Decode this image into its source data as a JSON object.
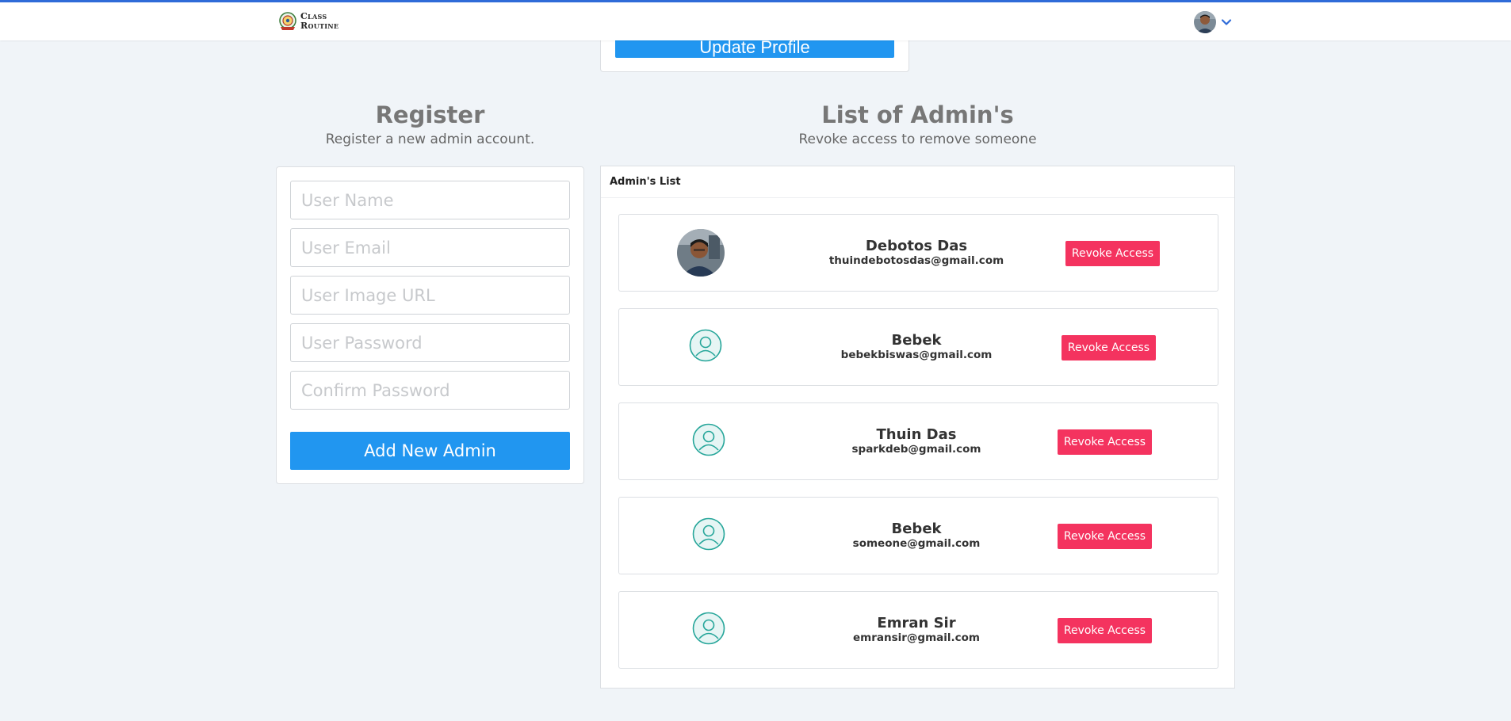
{
  "nav": {
    "brand_line1": "Class",
    "brand_line2": "Routine",
    "logo_icon": "class-routine-logo-icon",
    "dropdown_icon": "chevron-down-icon"
  },
  "profile": {
    "update_label": "Update Profile"
  },
  "register": {
    "title": "Register",
    "subtitle": "Register a new admin account.",
    "fields": [
      {
        "placeholder": "User Name",
        "value": ""
      },
      {
        "placeholder": "User Email",
        "value": ""
      },
      {
        "placeholder": "User Image URL",
        "value": ""
      },
      {
        "placeholder": "User Password",
        "value": ""
      },
      {
        "placeholder": "Confirm Password",
        "value": ""
      }
    ],
    "submit_label": "Add New Admin"
  },
  "admins": {
    "title": "List of Admin's",
    "subtitle": "Revoke access to remove someone",
    "list_header": "Admin's List",
    "revoke_label": "Revoke Access",
    "items": [
      {
        "name": "Debotos Das",
        "email": "thuindebotosdas@gmail.com",
        "avatar": "photo"
      },
      {
        "name": "Bebek",
        "email": "bebekbiswas@gmail.com",
        "avatar": "user-placeholder-icon"
      },
      {
        "name": "Thuin Das",
        "email": "sparkdeb@gmail.com",
        "avatar": "user-placeholder-icon"
      },
      {
        "name": "Bebek",
        "email": "someone@gmail.com",
        "avatar": "user-placeholder-icon"
      },
      {
        "name": "Emran Sir",
        "email": "emransir@gmail.com",
        "avatar": "user-placeholder-icon"
      }
    ]
  },
  "colors": {
    "accent": "#2196f0",
    "danger": "#f4335f",
    "topline": "#2f6bd8",
    "background": "#f0f4f8",
    "placeholder_icon": "#26a69a"
  }
}
